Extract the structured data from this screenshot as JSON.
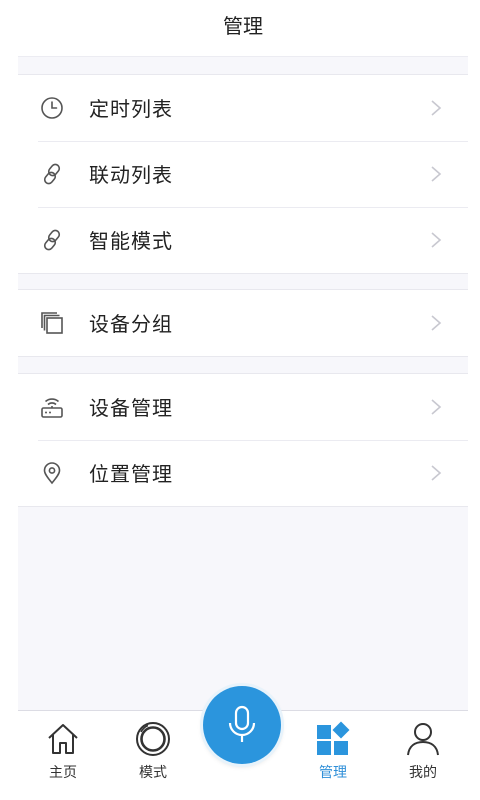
{
  "header": {
    "title": "管理"
  },
  "groups": [
    {
      "items": [
        {
          "label": "定时列表",
          "icon": "clock-icon"
        },
        {
          "label": "联动列表",
          "icon": "link-icon"
        },
        {
          "label": "智能模式",
          "icon": "link-icon"
        }
      ]
    },
    {
      "items": [
        {
          "label": "设备分组",
          "icon": "stack-icon"
        }
      ]
    },
    {
      "items": [
        {
          "label": "设备管理",
          "icon": "router-icon"
        },
        {
          "label": "位置管理",
          "icon": "location-pin-icon"
        }
      ]
    }
  ],
  "tabbar": {
    "tabs": [
      {
        "label": "主页",
        "icon": "home-icon"
      },
      {
        "label": "模式",
        "icon": "mode-ring-icon"
      },
      {
        "label": "管理",
        "icon": "grid-diamond-icon",
        "active": true
      },
      {
        "label": "我的",
        "icon": "user-icon"
      }
    ],
    "center": {
      "icon": "microphone-icon"
    }
  },
  "colors": {
    "accent": "#2b95dd",
    "active_tab": "#2f8fd8",
    "background": "#f7f7fb"
  }
}
